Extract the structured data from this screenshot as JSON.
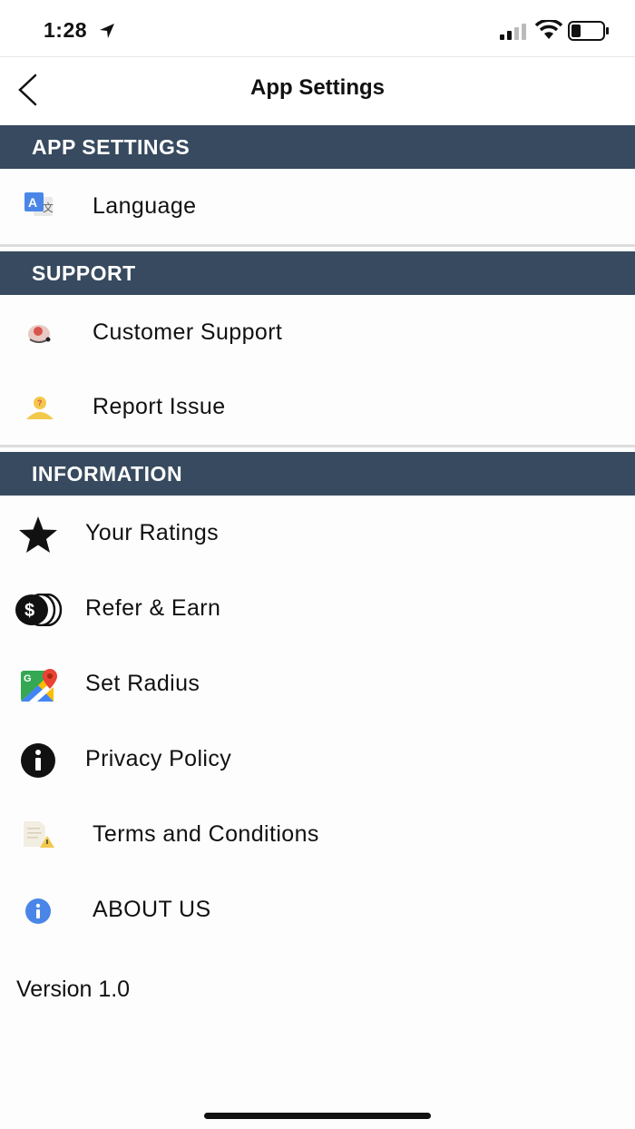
{
  "status_bar": {
    "time": "1:28"
  },
  "header": {
    "title": "App Settings",
    "back_icon": "chevron-left-icon"
  },
  "sections": [
    {
      "title": "APP SETTINGS",
      "items": [
        {
          "label": "Language",
          "icon": "translate-icon"
        }
      ]
    },
    {
      "title": "SUPPORT",
      "items": [
        {
          "label": "Customer Support",
          "icon": "support-agent-icon"
        },
        {
          "label": "Report Issue",
          "icon": "report-user-icon"
        }
      ]
    },
    {
      "title": "INFORMATION",
      "items": [
        {
          "label": "Your Ratings",
          "icon": "star-icon"
        },
        {
          "label": "Refer & Earn",
          "icon": "coins-icon"
        },
        {
          "label": "Set Radius",
          "icon": "maps-icon"
        },
        {
          "label": "Privacy Policy",
          "icon": "info-icon"
        },
        {
          "label": "Terms and Conditions",
          "icon": "document-warning-icon"
        },
        {
          "label": "ABOUT US",
          "icon": "info-blue-icon"
        }
      ]
    }
  ],
  "footer": {
    "version": "Version 1.0"
  },
  "colors": {
    "section_header": "#374a5f",
    "section_text": "#ffffff",
    "background": "#fdfdfd"
  }
}
